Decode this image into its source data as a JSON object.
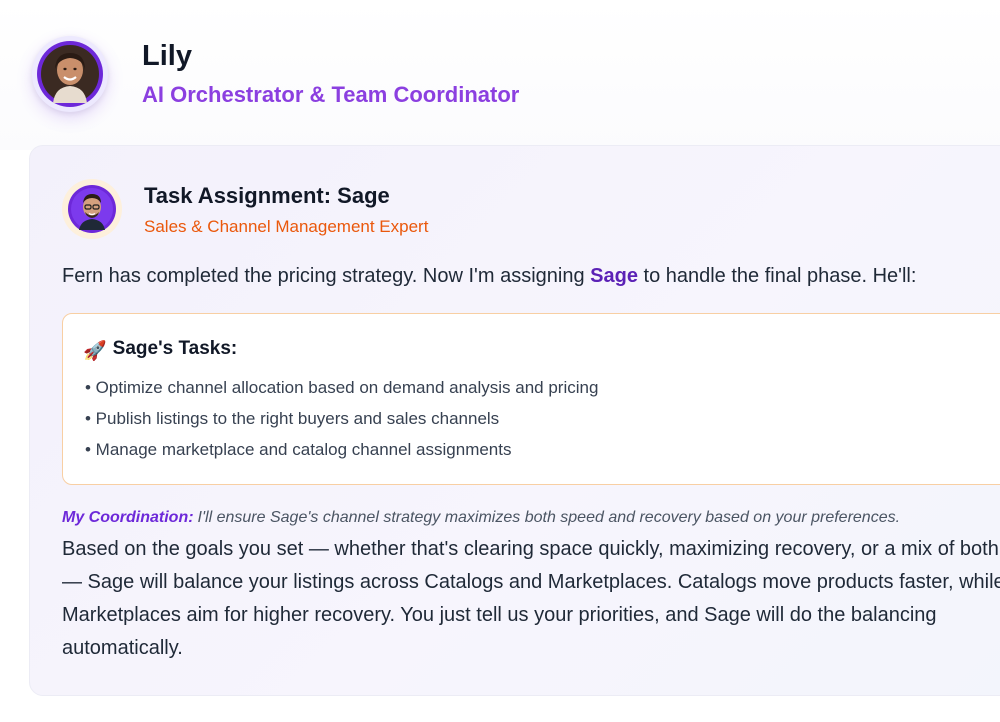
{
  "header": {
    "name": "Lily",
    "role": "AI Orchestrator & Team Coordinator"
  },
  "assignment": {
    "title": "Task Assignment: Sage",
    "subtitle": "Sales & Channel Management Expert",
    "intro_before": "Fern has completed the pricing strategy. Now I'm assigning ",
    "intro_highlight": "Sage",
    "intro_after": " to handle the final phase. He'll:"
  },
  "tasks": {
    "emoji": "🚀",
    "title": "Sage's Tasks:",
    "items": [
      "• Optimize channel allocation based on demand analysis and pricing",
      "• Publish listings to the right buyers and sales channels",
      "• Manage marketplace and catalog channel assignments"
    ]
  },
  "coordination": {
    "label": "My Coordination:",
    "text": "I'll ensure Sage's channel strategy maximizes both speed and recovery based on your preferences."
  },
  "paragraph": [
    "Based on the goals you set — whether that's clearing space quickly, maximizing recovery, or a mix of both",
    "— Sage will balance your listings across Catalogs and Marketplaces. Catalogs move products faster, while",
    "Marketplaces aim for higher recovery. You just tell us your priorities, and Sage will do the balancing",
    "automatically."
  ],
  "colors": {
    "accent_purple": "#8b3fe0",
    "accent_orange": "#ea580c",
    "highlight_purple": "#5b21b6"
  }
}
